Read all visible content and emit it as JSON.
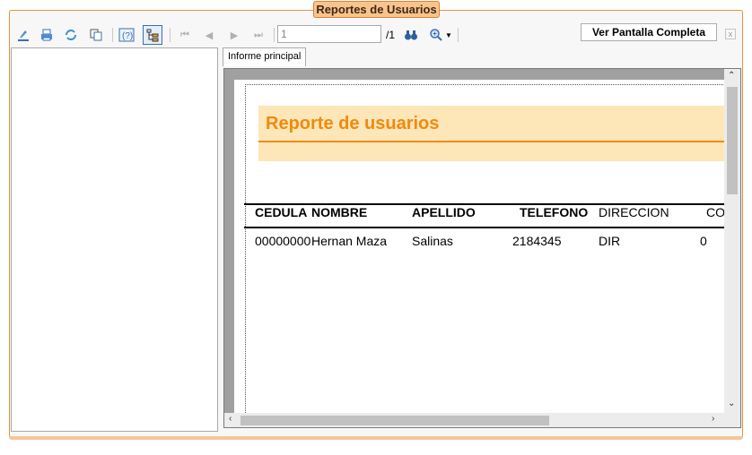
{
  "window": {
    "title": "Reportes de Usuarios"
  },
  "toolbar": {
    "page_value": "1",
    "page_total": "/1",
    "fullscreen_label": "Ver Pantalla Completa",
    "close_label": "x"
  },
  "tabs": [
    {
      "label": "Informe principal"
    }
  ],
  "report": {
    "title": "Reporte de usuarios",
    "columns": [
      "CEDULA",
      "NOMBRE",
      "APELLIDO",
      "TELEFONO",
      "DIRECCION",
      "CO"
    ],
    "rows": [
      [
        "00000000",
        "Hernan Maza",
        "Salinas",
        "2184345",
        "DIR",
        "0"
      ]
    ]
  },
  "colors": {
    "accent": "#f08a0c",
    "banner": "#fde6b8",
    "frame": "#e8913f"
  }
}
